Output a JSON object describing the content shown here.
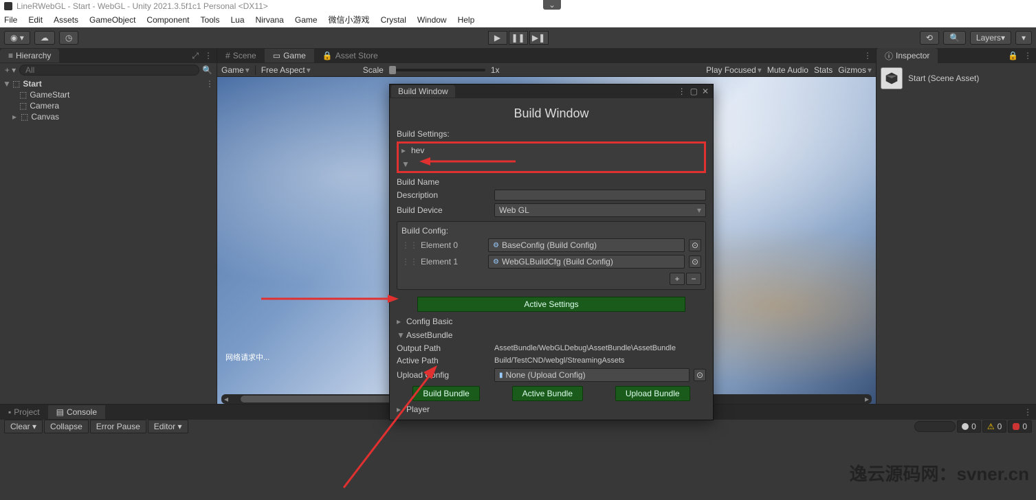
{
  "titlebar": {
    "text": "LineRWebGL - Start - WebGL - Unity 2021.3.5f1c1 Personal <DX11>"
  },
  "menu": [
    "File",
    "Edit",
    "Assets",
    "GameObject",
    "Component",
    "Tools",
    "Lua",
    "Nirvana",
    "Game",
    "微信小游戏",
    "Crystal",
    "Window",
    "Help"
  ],
  "toolbar": {
    "layers": "Layers"
  },
  "hierarchy": {
    "tab": "Hierarchy",
    "search_placeholder": "All",
    "scene": "Start",
    "items": [
      "GameStart",
      "Camera",
      "Canvas"
    ]
  },
  "center": {
    "tabs": [
      "Scene",
      "Game",
      "Asset Store"
    ],
    "game_toolbar": {
      "display": "Game",
      "aspect": "Free Aspect",
      "scale_label": "Scale",
      "scale_value": "1x",
      "play_focused": "Play Focused",
      "mute": "Mute Audio",
      "stats": "Stats",
      "gizmos": "Gizmos"
    },
    "loading": "网络请求中..."
  },
  "inspector": {
    "tab": "Inspector",
    "asset_name": "Start (Scene Asset)"
  },
  "bottom": {
    "tabs": [
      "Project",
      "Console"
    ],
    "console": {
      "clear": "Clear",
      "collapse": "Collapse",
      "error_pause": "Error Pause",
      "editor": "Editor",
      "info_count": "0",
      "warn_count": "0",
      "err_count": "0"
    }
  },
  "build_window": {
    "tab": "Build Window",
    "title": "Build Window",
    "build_settings_label": "Build Settings:",
    "hev": "hev",
    "build_name_label": "Build Name",
    "description_label": "Description",
    "build_device_label": "Build Device",
    "build_device_value": "Web GL",
    "build_config_label": "Build Config:",
    "elements": [
      {
        "label": "Element 0",
        "value": "BaseConfig (Build Config)"
      },
      {
        "label": "Element 1",
        "value": "WebGLBuildCfg (Build Config)"
      }
    ],
    "active_settings": "Active Settings",
    "config_basic": "Config Basic",
    "asset_bundle": "AssetBundle",
    "output_path_label": "Output Path",
    "output_path_value": "AssetBundle/WebGLDebug\\AssetBundle\\AssetBundle",
    "active_path_label": "Active Path",
    "active_path_value": "Build/TestCND/webgl/StreamingAssets",
    "upload_config_label": "Upload Config",
    "upload_config_value": "None (Upload Config)",
    "build_bundle": "Build Bundle",
    "active_bundle": "Active Bundle",
    "upload_bundle": "Upload Bundle",
    "player": "Player"
  },
  "watermark": "逸云源码网：svner.cn"
}
